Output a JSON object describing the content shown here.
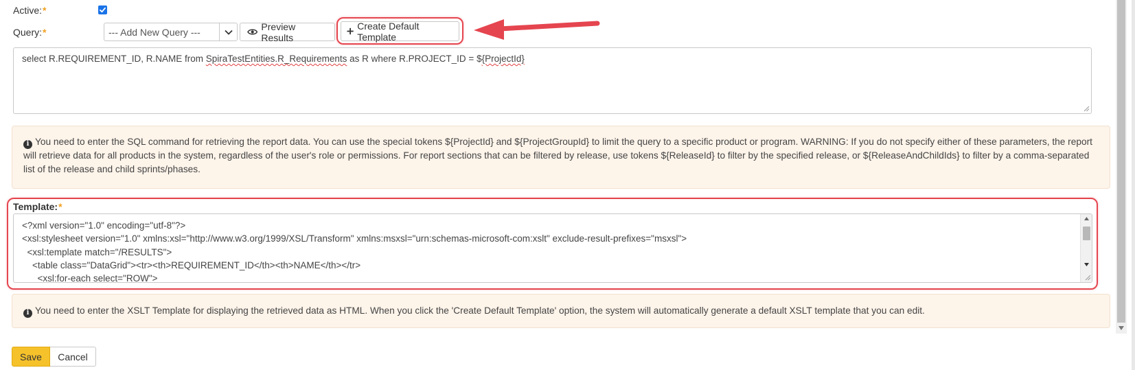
{
  "form": {
    "active": {
      "label": "Active:",
      "required_mark": "*",
      "checked": true
    },
    "query": {
      "label": "Query:",
      "required_mark": "*",
      "select_value": "--- Add New Query ---",
      "preview_label": "Preview Results",
      "create_template_label": "Create Default Template",
      "sql_prefix": "select R.REQUIREMENT_ID, R.NAME from ",
      "sql_entity": "SpiraTestEntities.R_Requirements",
      "sql_middle": " as R where R.PROJECT_ID = $",
      "sql_token": "{ProjectId}",
      "help_text": "You need to enter the SQL command for retrieving the report data. You can use the special tokens ${ProjectId} and ${ProjectGroupId} to limit the query to a specific product or program. WARNING: If you do not specify either of these parameters, the report will retrieve data for all products in the system, regardless of the user's role or permissions. For report sections that can be filtered by release, use tokens ${ReleaseId} to filter by the specified release, or ${ReleaseAndChildIds} to filter by a comma-separated list of the release and child sprints/phases."
    },
    "template": {
      "label": "Template:",
      "required_mark": "*",
      "lines": [
        "<?xml version=\"1.0\" encoding=\"utf-8\"?>",
        "<xsl:stylesheet version=\"1.0\" xmlns:xsl=\"http://www.w3.org/1999/XSL/Transform\" xmlns:msxsl=\"urn:schemas-microsoft-com:xslt\" exclude-result-prefixes=\"msxsl\">",
        "  <xsl:template match=\"/RESULTS\">",
        "    <table class=\"DataGrid\"><tr><th>REQUIREMENT_ID</th><th>NAME</th></tr>",
        "      <xsl:for-each select=\"ROW\">"
      ],
      "help_text": "You need to enter the XSLT Template for displaying the retrieved data as HTML. When you click the 'Create Default Template' option, the system will automatically generate a default XSLT template that you can edit."
    },
    "buttons": {
      "save": "Save",
      "cancel": "Cancel"
    }
  },
  "colors": {
    "highlight_red": "#e5454f",
    "save_yellow": "#f6c22b",
    "info_background": "#fdf4ea",
    "checkbox_blue": "#1a73e8"
  },
  "icons": {
    "preview": "eye-icon",
    "create": "plus-icon",
    "dropdown": "chevron-down-icon",
    "info": "info-circle-icon",
    "checkbox": "check-icon"
  }
}
